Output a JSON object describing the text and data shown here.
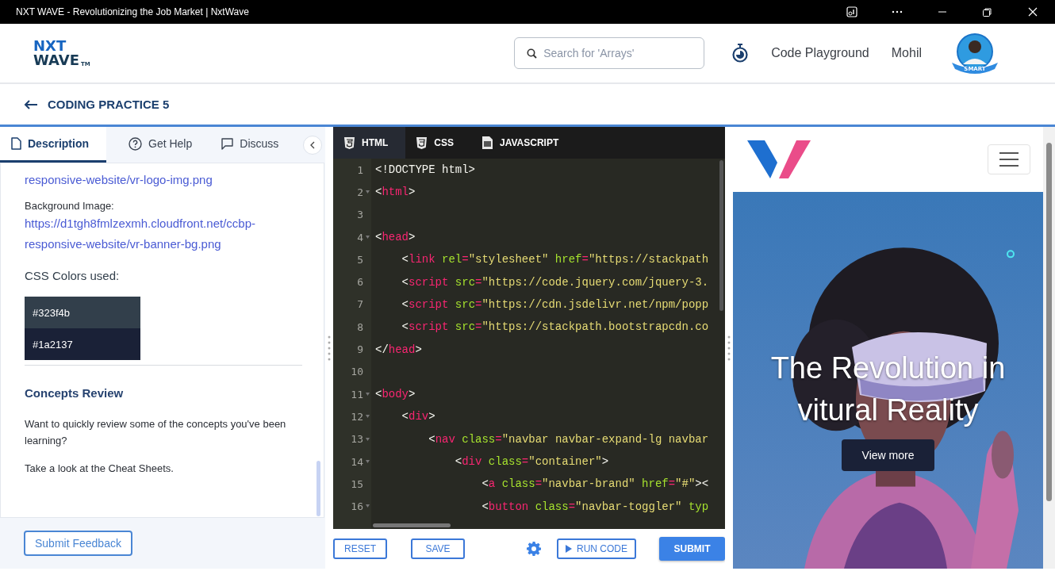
{
  "window": {
    "title": "NXT WAVE - Revolutionizing the Job Market | NxtWave"
  },
  "header": {
    "logo": {
      "top": "NXT",
      "bottom": "WAVE",
      "mark": "TM"
    },
    "search": {
      "placeholder": "Search for 'Arrays'"
    },
    "nav": [
      "Code Playground",
      "Mohil"
    ],
    "avatar_badge": "SMART"
  },
  "page_title": "CODING PRACTICE 5",
  "left_panel": {
    "tabs": [
      {
        "label": "Description",
        "selected": true
      },
      {
        "label": "Get Help",
        "selected": false
      },
      {
        "label": "Discuss",
        "selected": false
      }
    ],
    "content": [
      {
        "kind": "link",
        "text": "responsive-website/vr-logo-img.png"
      },
      {
        "kind": "label",
        "text": "Background Image:"
      },
      {
        "kind": "link",
        "text": "https://d1tgh8fmlzexmh.cloudfront.net/ccbp-responsive-website/vr-banner-bg.png"
      },
      {
        "kind": "subheading",
        "text": "CSS Colors used:"
      },
      {
        "kind": "swatches",
        "items": [
          {
            "label": "#323f4b",
            "color": "#323f4b"
          },
          {
            "label": "#1a2137",
            "color": "#1a2137"
          }
        ]
      },
      {
        "kind": "divider"
      },
      {
        "kind": "heading",
        "text": "Concepts Review"
      },
      {
        "kind": "paragraph",
        "text": "Want to quickly review some of the concepts you've been learning?"
      },
      {
        "kind": "paragraph",
        "text": "Take a look at the Cheat Sheets."
      }
    ],
    "feedback_button": "Submit Feedback"
  },
  "editor": {
    "tabs": [
      {
        "label": "HTML",
        "selected": true
      },
      {
        "label": "CSS",
        "selected": false
      },
      {
        "label": "JAVASCRIPT",
        "selected": false
      }
    ],
    "lines": [
      {
        "number": "1",
        "fold": false,
        "tokens": [
          {
            "kind": "plain",
            "text": "<!DOCTYPE html>"
          }
        ]
      },
      {
        "number": "2",
        "fold": true,
        "tokens": [
          {
            "kind": "plain",
            "text": "<"
          },
          {
            "kind": "tag",
            "text": "html"
          },
          {
            "kind": "plain",
            "text": ">"
          }
        ]
      },
      {
        "number": "3",
        "fold": false
      },
      {
        "number": "4",
        "fold": true,
        "tokens": [
          {
            "kind": "plain",
            "text": "<"
          },
          {
            "kind": "tag",
            "text": "head"
          },
          {
            "kind": "plain",
            "text": ">"
          }
        ]
      },
      {
        "number": "5",
        "fold": false,
        "tokens": [
          {
            "kind": "plain",
            "text": "    <"
          },
          {
            "kind": "tag",
            "text": "link"
          },
          {
            "kind": "attr",
            "text": " rel"
          },
          {
            "kind": "op",
            "text": "="
          },
          {
            "kind": "string",
            "text": "\"stylesheet\""
          },
          {
            "kind": "attr",
            "text": " href"
          },
          {
            "kind": "op",
            "text": "="
          },
          {
            "kind": "string",
            "text": "\"https://stackpath"
          }
        ]
      },
      {
        "number": "6",
        "fold": false,
        "tokens": [
          {
            "kind": "plain",
            "text": "    <"
          },
          {
            "kind": "tag",
            "text": "script"
          },
          {
            "kind": "attr",
            "text": " src"
          },
          {
            "kind": "op",
            "text": "="
          },
          {
            "kind": "string",
            "text": "\"https://code.jquery.com/jquery-3."
          }
        ]
      },
      {
        "number": "7",
        "fold": false,
        "tokens": [
          {
            "kind": "plain",
            "text": "    <"
          },
          {
            "kind": "tag",
            "text": "script"
          },
          {
            "kind": "attr",
            "text": " src"
          },
          {
            "kind": "op",
            "text": "="
          },
          {
            "kind": "string",
            "text": "\"https://cdn.jsdelivr.net/npm/popp"
          }
        ]
      },
      {
        "number": "8",
        "fold": false,
        "tokens": [
          {
            "kind": "plain",
            "text": "    <"
          },
          {
            "kind": "tag",
            "text": "script"
          },
          {
            "kind": "attr",
            "text": " src"
          },
          {
            "kind": "op",
            "text": "="
          },
          {
            "kind": "string",
            "text": "\"https://stackpath.bootstrapcdn.co"
          }
        ]
      },
      {
        "number": "9",
        "fold": false,
        "tokens": [
          {
            "kind": "plain",
            "text": "</"
          },
          {
            "kind": "tag",
            "text": "head"
          },
          {
            "kind": "plain",
            "text": ">"
          }
        ]
      },
      {
        "number": "10",
        "fold": false
      },
      {
        "number": "11",
        "fold": true,
        "tokens": [
          {
            "kind": "plain",
            "text": "<"
          },
          {
            "kind": "tag",
            "text": "body"
          },
          {
            "kind": "plain",
            "text": ">"
          }
        ]
      },
      {
        "number": "12",
        "fold": true,
        "tokens": [
          {
            "kind": "plain",
            "text": "    <"
          },
          {
            "kind": "tag",
            "text": "div"
          },
          {
            "kind": "plain",
            "text": ">"
          }
        ]
      },
      {
        "number": "13",
        "fold": true,
        "tokens": [
          {
            "kind": "plain",
            "text": "        <"
          },
          {
            "kind": "tag",
            "text": "nav"
          },
          {
            "kind": "attr",
            "text": " class"
          },
          {
            "kind": "op",
            "text": "="
          },
          {
            "kind": "string",
            "text": "\"navbar navbar-expand-lg navbar"
          }
        ]
      },
      {
        "number": "14",
        "fold": true,
        "tokens": [
          {
            "kind": "plain",
            "text": "            <"
          },
          {
            "kind": "tag",
            "text": "div"
          },
          {
            "kind": "attr",
            "text": " class"
          },
          {
            "kind": "op",
            "text": "="
          },
          {
            "kind": "string",
            "text": "\"container\""
          },
          {
            "kind": "plain",
            "text": ">"
          }
        ]
      },
      {
        "number": "15",
        "fold": false,
        "tokens": [
          {
            "kind": "plain",
            "text": "                <"
          },
          {
            "kind": "tag",
            "text": "a"
          },
          {
            "kind": "attr",
            "text": " class"
          },
          {
            "kind": "op",
            "text": "="
          },
          {
            "kind": "string",
            "text": "\"navbar-brand\""
          },
          {
            "kind": "attr",
            "text": " href"
          },
          {
            "kind": "op",
            "text": "="
          },
          {
            "kind": "string",
            "text": "\"#\""
          },
          {
            "kind": "plain",
            "text": "><"
          }
        ]
      },
      {
        "number": "16",
        "fold": true,
        "tokens": [
          {
            "kind": "plain",
            "text": "                <"
          },
          {
            "kind": "tag",
            "text": "button"
          },
          {
            "kind": "attr",
            "text": " class"
          },
          {
            "kind": "op",
            "text": "="
          },
          {
            "kind": "string",
            "text": "\"navbar-toggler\""
          },
          {
            "kind": "attr",
            "text": " typ"
          }
        ]
      }
    ],
    "buttons": [
      {
        "kind": "outline",
        "label": "RESET"
      },
      {
        "kind": "outline",
        "label": "SAVE"
      },
      {
        "kind": "settings"
      },
      {
        "kind": "run",
        "label": "RUN CODE"
      },
      {
        "kind": "filled",
        "label": "SUBMIT"
      }
    ]
  },
  "preview": {
    "heading": "The Revolution in vitural Reality",
    "button": "View more"
  }
}
